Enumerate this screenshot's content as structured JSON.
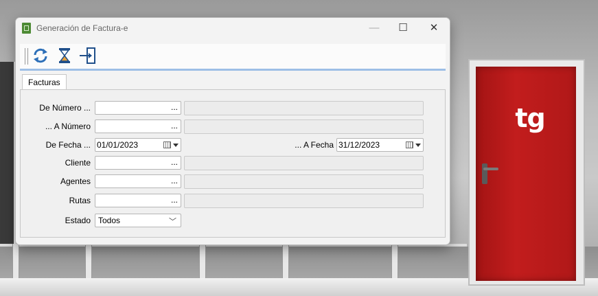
{
  "window": {
    "title": "Generación de Factura-e",
    "controls": {
      "minimize": "—",
      "maximize": "☐",
      "close": "✕"
    }
  },
  "toolbar": {
    "buttons": [
      {
        "name": "refresh",
        "icon": "refresh-icon"
      },
      {
        "name": "hourglass",
        "icon": "hourglass-icon"
      },
      {
        "name": "exit",
        "icon": "exit-door-icon"
      }
    ]
  },
  "tabs": [
    "Facturas"
  ],
  "form": {
    "de_numero": {
      "label": "De Número ...",
      "value": "",
      "button": "..."
    },
    "a_numero": {
      "label": "... A Número",
      "value": "",
      "button": "..."
    },
    "de_fecha": {
      "label": "De Fecha ...",
      "value": "01/01/2023"
    },
    "a_fecha": {
      "label": "... A Fecha",
      "value": "31/12/2023"
    },
    "cliente": {
      "label": "Cliente",
      "value": "",
      "button": "..."
    },
    "agentes": {
      "label": "Agentes",
      "value": "",
      "button": "..."
    },
    "rutas": {
      "label": "Rutas",
      "value": "",
      "button": "..."
    },
    "estado": {
      "label": "Estado",
      "value": "Todos"
    }
  },
  "background": {
    "door_logo": "tg"
  },
  "colors": {
    "door": "#b81a1a",
    "accent": "#9dbfe6",
    "app_icon": "#4d8a34"
  }
}
